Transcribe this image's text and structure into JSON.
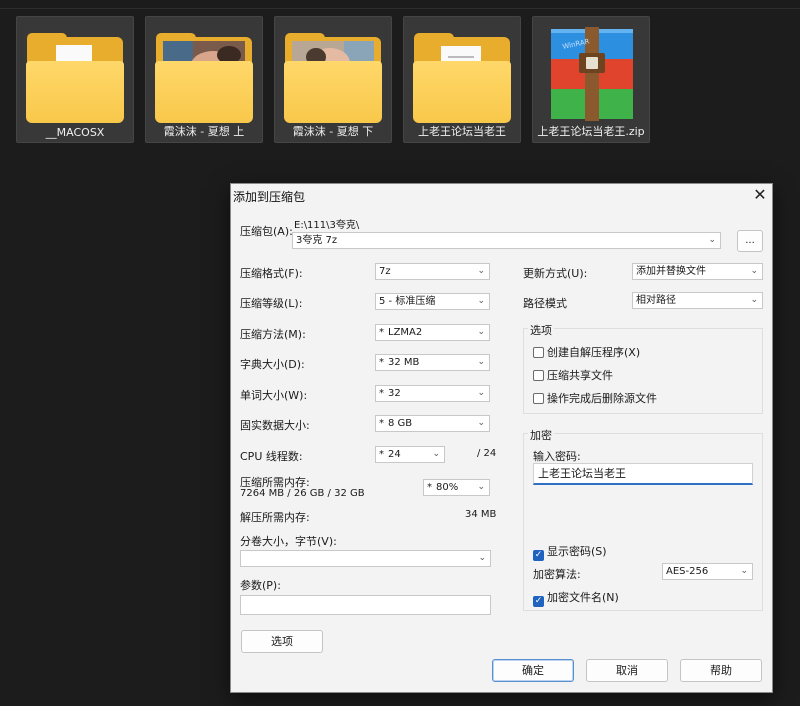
{
  "explorer": {
    "files": [
      {
        "name": "__MACOSX",
        "kind": "folder-doc"
      },
      {
        "name": "霞沫沫 - 夏想 上",
        "kind": "folder-photo"
      },
      {
        "name": "霞沫沫 - 夏想 下",
        "kind": "folder-photo"
      },
      {
        "name": "上老王论坛当老王",
        "kind": "folder-doc"
      },
      {
        "name": "上老王论坛当老王.zip",
        "kind": "winrar-archive"
      }
    ]
  },
  "dialog": {
    "title": "添加到压缩包",
    "close_glyph": "✕",
    "archive_label": "压缩包(A):",
    "archive_path": "E:\\111\\3夸克\\",
    "archive_name": "3夸克 7z",
    "browse_label": "...",
    "left": {
      "format_label": "压缩格式(F):",
      "format_value": "7z",
      "level_label": "压缩等级(L):",
      "level_value": "5 - 标准压缩",
      "method_label": "压缩方法(M):",
      "method_value": "LZMA2",
      "dict_label": "字典大小(D):",
      "dict_value": "32 MB",
      "word_label": "单词大小(W):",
      "word_value": "32",
      "solid_label": "固实数据大小:",
      "solid_value": "8 GB",
      "cpu_label": "CPU 线程数:",
      "cpu_value": "24",
      "cpu_max": "/ 24",
      "mem_label": "压缩所需内存:",
      "mem_detail": "7264 MB / 26 GB / 32 GB",
      "mem_percent": "80%",
      "decomp_label": "解压所需内存:",
      "decomp_value": "34 MB",
      "split_label": "分卷大小，字节(V):",
      "split_value": "",
      "params_label": "参数(P):",
      "params_value": "",
      "options_button": "选项"
    },
    "right": {
      "update_label": "更新方式(U):",
      "update_value": "添加并替换文件",
      "pathmode_label": "路径模式",
      "pathmode_value": "相对路径",
      "options_group": "选项",
      "opt_sfx": "创建自解压程序(X)",
      "opt_sfx_checked": false,
      "opt_shared": "压缩共享文件",
      "opt_shared_checked": false,
      "opt_delete": "操作完成后删除源文件",
      "opt_delete_checked": false,
      "encrypt_group": "加密",
      "password_label": "输入密码:",
      "password_value": "上老王论坛当老王",
      "show_pwd": "显示密码(S)",
      "show_pwd_checked": true,
      "enc_method_label": "加密算法:",
      "enc_method_value": "AES-256",
      "enc_names": "加密文件名(N)",
      "enc_names_checked": true
    },
    "buttons": {
      "ok": "确定",
      "cancel": "取消",
      "help": "帮助"
    }
  },
  "colors": {
    "folder": "#f8c84a",
    "accent": "#1f62c0",
    "explorer_bg": "#1c1c1c"
  }
}
